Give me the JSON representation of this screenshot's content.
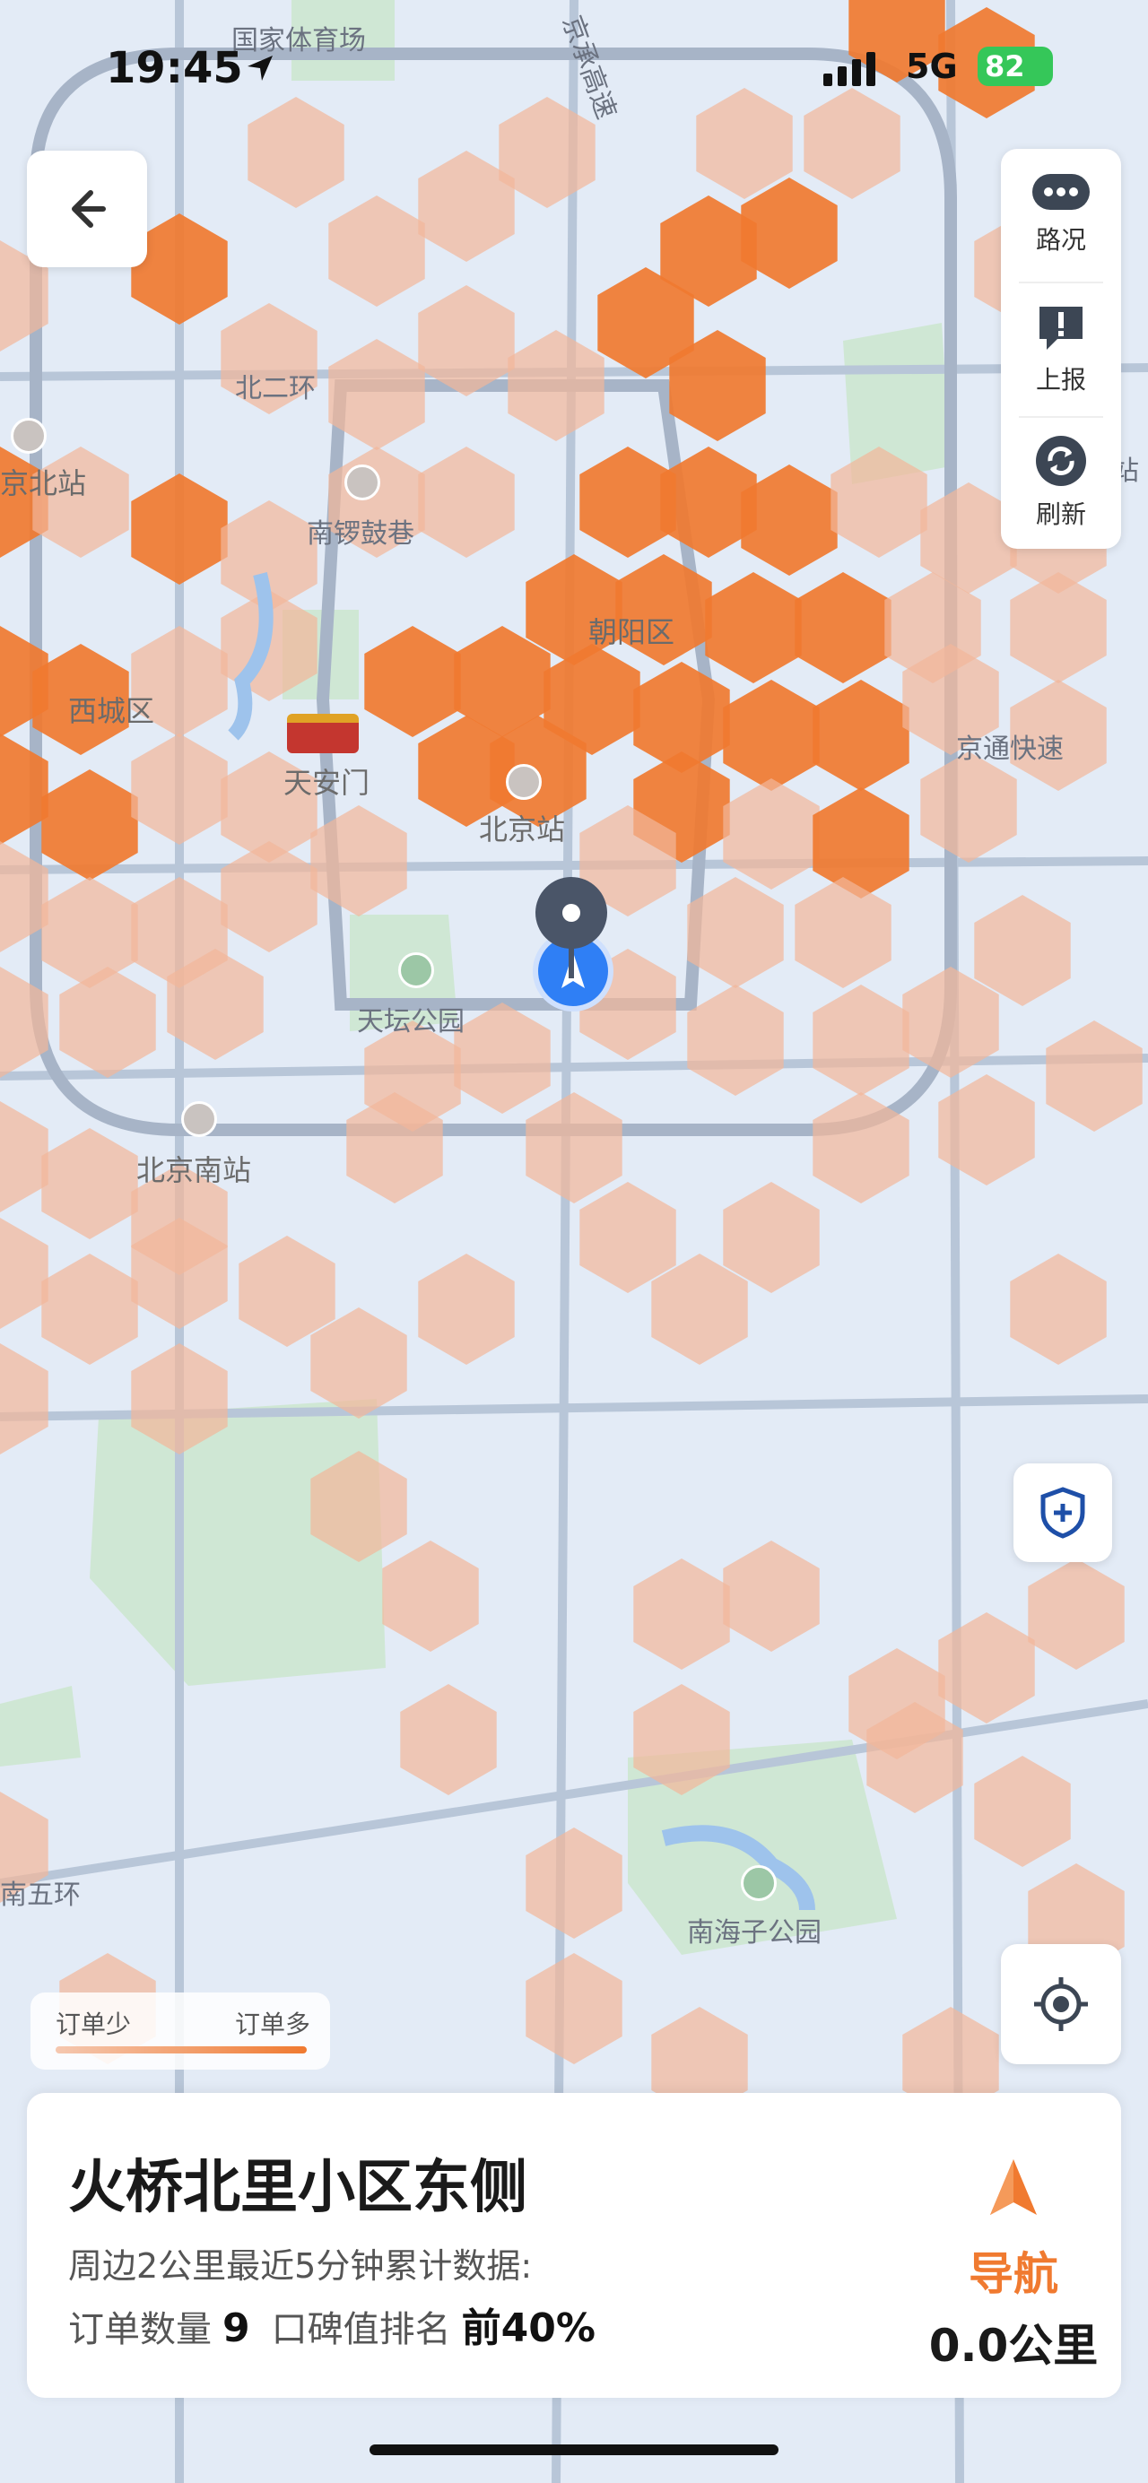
{
  "status_bar": {
    "time": "19:45",
    "network": "5G",
    "battery": "82"
  },
  "map": {
    "labels": {
      "stadium": "国家体育场",
      "expressway_top": "京承高速",
      "north_2nd_ring": "北二环",
      "beijing_north_station": "京北站",
      "nanluoguxiang": "南锣鼓巷",
      "chaoyang": "朝阳区",
      "xicheng": "西城区",
      "tiananmen": "天安门",
      "beijing_station": "北京站",
      "jingtong_expressway": "京通快速",
      "temple_of_heaven": "天坛公园",
      "beijing_south_station": "北京南站",
      "south_5th_ring": "南五环",
      "nanhaizi_park": "南海子公园",
      "right_edge": "站",
      "right_edge_speed": "速"
    }
  },
  "controls": {
    "traffic": "路况",
    "report": "上报",
    "refresh": "刷新"
  },
  "legend": {
    "low": "订单少",
    "high": "订单多"
  },
  "card": {
    "title": "火桥北里小区东侧",
    "subtitle": "周边2公里最近5分钟累计数据:",
    "order_label": "订单数量",
    "order_value": "9",
    "rank_label": "口碑值排名",
    "rank_value": "前40%",
    "nav_label": "导航",
    "distance": "0.0公里"
  },
  "colors": {
    "hex_dark": "#f07a30",
    "hex_light": "#f2b69a",
    "map_bg": "#e3ebf6",
    "accent": "#f07a30"
  }
}
